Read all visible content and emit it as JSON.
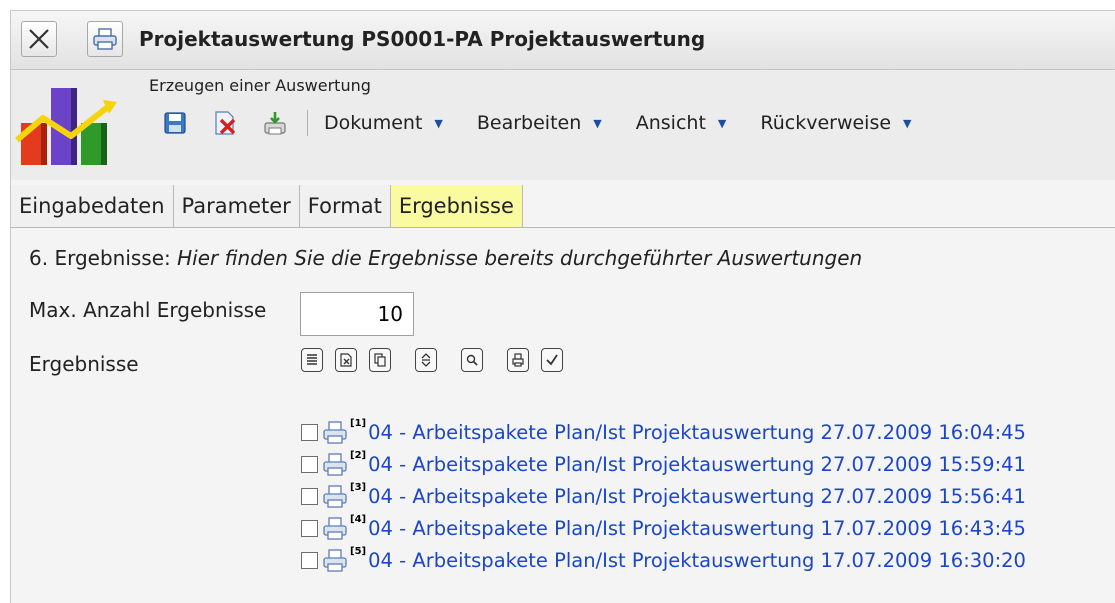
{
  "window": {
    "title": "Projektauswertung PS0001-PA Projektauswertung",
    "close_icon": "close-icon",
    "print_icon": "printer-icon"
  },
  "header": {
    "subtitle": "Erzeugen einer Auswertung",
    "logo_icon": "chart-logo-icon",
    "toolbar_icons": [
      "save-icon",
      "delete-icon",
      "export-icon"
    ],
    "menus": [
      {
        "label": "Dokument"
      },
      {
        "label": "Bearbeiten"
      },
      {
        "label": "Ansicht"
      },
      {
        "label": "Rückverweise"
      }
    ]
  },
  "tabs": [
    {
      "label": "Eingabedaten",
      "active": false
    },
    {
      "label": "Parameter",
      "active": false
    },
    {
      "label": "Format",
      "active": false
    },
    {
      "label": "Ergebnisse",
      "active": true
    }
  ],
  "content": {
    "heading_prefix": "6. Ergebnisse:",
    "heading_text": "Hier finden Sie die Ergebnisse bereits durchgeführter Auswertungen",
    "max_label": "Max. Anzahl Ergebnisse",
    "max_value": "10",
    "results_label": "Ergebnisse",
    "result_actions": [
      "list-icon",
      "delete-icon",
      "copy-icon",
      "sort-icon",
      "search-icon",
      "print-icon",
      "check-icon"
    ],
    "results": [
      {
        "index": "[1]",
        "text": "04 - Arbeitspakete Plan/Ist Projektauswertung 27.07.2009 16:04:45"
      },
      {
        "index": "[2]",
        "text": "04 - Arbeitspakete Plan/Ist Projektauswertung 27.07.2009 15:59:41"
      },
      {
        "index": "[3]",
        "text": "04 - Arbeitspakete Plan/Ist Projektauswertung 27.07.2009 15:56:41"
      },
      {
        "index": "[4]",
        "text": "04 - Arbeitspakete Plan/Ist Projektauswertung 17.07.2009 16:43:45"
      },
      {
        "index": "[5]",
        "text": "04 - Arbeitspakete Plan/Ist Projektauswertung 17.07.2009 16:30:20"
      }
    ]
  },
  "colors": {
    "active_tab": "#fafaa0",
    "link": "#1b47c6"
  }
}
